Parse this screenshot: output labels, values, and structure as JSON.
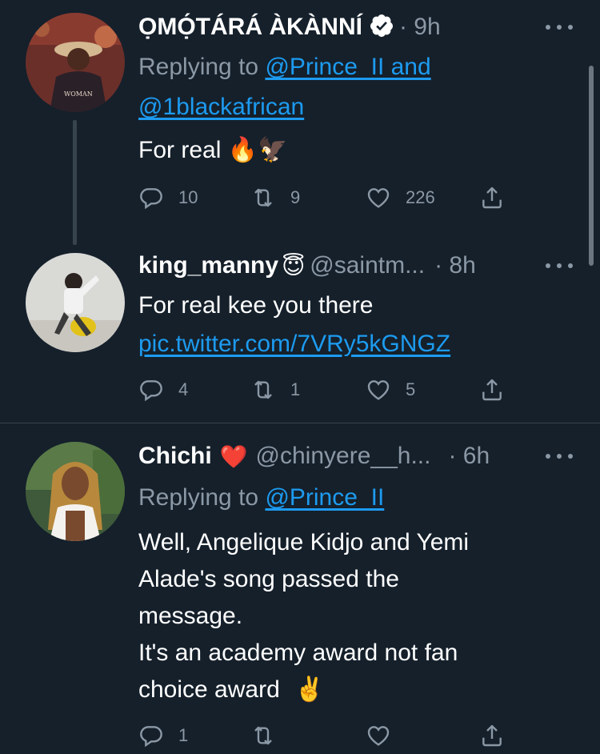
{
  "tweets": [
    {
      "name": "ỌMỌ́TÁRÁ ÀKÀNNÍ",
      "verified": true,
      "time": "· 9h",
      "replying_label": "Replying to",
      "replying_to_1": "@Prince_II and",
      "replying_to_2": "@1blackafrican",
      "text": "For real",
      "emojis": "🔥🦅",
      "replies": "10",
      "retweets": "9",
      "likes": "226"
    },
    {
      "name": "king_manny",
      "emoji": "😇",
      "handle": "@saintm...",
      "time": "· 8h",
      "text": "For real kee you there",
      "link": "pic.twitter.com/7VRy5kGNGZ",
      "replies": "4",
      "retweets": "1",
      "likes": "5"
    },
    {
      "name": "Chichi",
      "emoji": "❤️",
      "handle": "@chinyere__h...",
      "time": "· 6h",
      "replying_label": "Replying to",
      "replying_to": "@Prince_II",
      "lines": [
        "Well, Angelique Kidjo and Yemi",
        "Alade's song passed the",
        "message.",
        "It's an academy award not fan",
        "choice award"
      ],
      "end_emoji": "✌️",
      "replies": "1"
    }
  ],
  "colors": {
    "background": "#15202b",
    "link": "#1d9bf0",
    "muted": "#8b98a5",
    "divider": "#38444d"
  }
}
